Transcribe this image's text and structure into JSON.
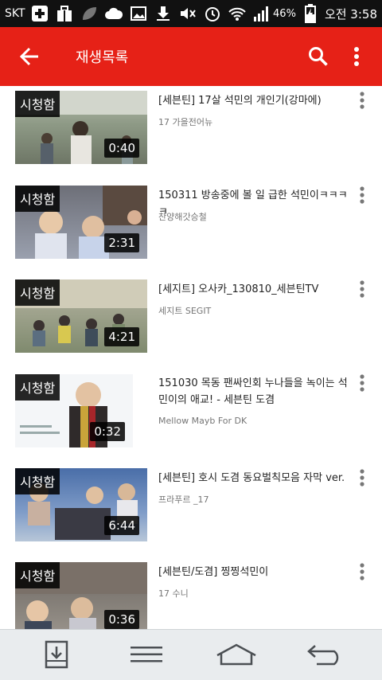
{
  "status_bar": {
    "carrier": "SKT",
    "battery_percent": "46%",
    "clock": "오전 3:58",
    "icons": [
      "medical-cross-icon",
      "gift-icon",
      "leaf-icon",
      "cloud-icon",
      "image-icon",
      "download-icon",
      "mute-icon",
      "alarm-icon",
      "wifi-icon",
      "signal-icon",
      "battery-charging-icon"
    ]
  },
  "app_bar": {
    "title": "재생목록",
    "accent_color": "#e62117"
  },
  "videos": [
    {
      "badge": "시청함",
      "duration": "0:40",
      "title": "[세븐틴] 17살 석민의 개인기(강마에)",
      "channel": "17 가을전어뉴"
    },
    {
      "badge": "시청함",
      "duration": "2:31",
      "title": "150311 방송중에 볼 일 급한 석민이ㅋㅋㅋㅋ",
      "channel": "찬양해갓승철"
    },
    {
      "badge": "시청함",
      "duration": "4:21",
      "title": "[세지트] 오사카_130810_세븐틴TV",
      "channel": "세지트 SEGIT"
    },
    {
      "badge": "시청함",
      "duration": "0:32",
      "title": "151030 목동 팬싸인회 누나들을 녹이는 석민이의 애교! - 세븐틴 도겸",
      "channel": "Mellow Mayb For DK"
    },
    {
      "badge": "시청함",
      "duration": "6:44",
      "title": "[세븐틴] 호시 도겸 동요벌칙모음 자막 ver.",
      "channel": "프라푸르 _17"
    },
    {
      "badge": "시청함",
      "duration": "0:36",
      "title": "[세븐틴/도겸] 찡찡석민이",
      "channel": "17 수니"
    }
  ],
  "nav_bar": {
    "icons": [
      "save-to-tray-icon",
      "menu-icon",
      "home-icon",
      "back-icon"
    ]
  }
}
